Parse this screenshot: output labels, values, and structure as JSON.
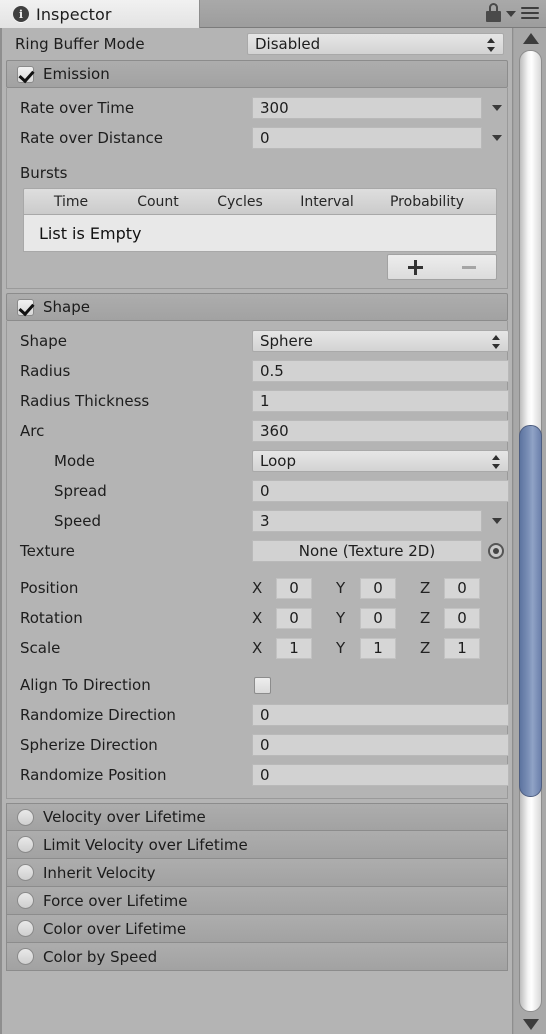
{
  "window": {
    "tab_label": "Inspector",
    "info_icon": "info-icon",
    "lock_icon": "lock-icon",
    "menu_icon": "hamburger-menu-icon"
  },
  "top_field": {
    "label": "Ring Buffer Mode",
    "value": "Disabled"
  },
  "emission": {
    "title": "Emission",
    "enabled": true,
    "rate_over_time": {
      "label": "Rate over Time",
      "value": "300"
    },
    "rate_over_distance": {
      "label": "Rate over Distance",
      "value": "0"
    },
    "bursts_label": "Bursts",
    "bursts_columns": [
      "Time",
      "Count",
      "Cycles",
      "Interval",
      "Probability"
    ],
    "bursts_empty_text": "List is Empty",
    "add_label": "+",
    "remove_label": "−"
  },
  "shape": {
    "title": "Shape",
    "enabled": true,
    "rows": [
      {
        "label": "Shape",
        "value": "Sphere",
        "type": "popup"
      },
      {
        "label": "Radius",
        "value": "0.5",
        "type": "text"
      },
      {
        "label": "Radius Thickness",
        "value": "1",
        "type": "text"
      },
      {
        "label": "Arc",
        "value": "360",
        "type": "text"
      },
      {
        "label": "Mode",
        "value": "Loop",
        "type": "popup",
        "indent": true
      },
      {
        "label": "Spread",
        "value": "0",
        "type": "text",
        "indent": true
      },
      {
        "label": "Speed",
        "value": "3",
        "type": "text-caret",
        "indent": true
      },
      {
        "label": "Texture",
        "value": "None (Texture 2D)",
        "type": "object"
      }
    ],
    "position": {
      "label": "Position",
      "x": "0",
      "y": "0",
      "z": "0"
    },
    "rotation": {
      "label": "Rotation",
      "x": "0",
      "y": "0",
      "z": "0"
    },
    "scale": {
      "label": "Scale",
      "x": "1",
      "y": "1",
      "z": "1"
    },
    "axes": {
      "x": "X",
      "y": "Y",
      "z": "Z"
    },
    "align_to_direction": {
      "label": "Align To Direction",
      "checked": false
    },
    "randomize_direction": {
      "label": "Randomize Direction",
      "value": "0"
    },
    "spherize_direction": {
      "label": "Spherize Direction",
      "value": "0"
    },
    "randomize_position": {
      "label": "Randomize Position",
      "value": "0"
    }
  },
  "collapsed_modules": [
    {
      "title": "Velocity over Lifetime",
      "enabled": false
    },
    {
      "title": "Limit Velocity over Lifetime",
      "enabled": false
    },
    {
      "title": "Inherit Velocity",
      "enabled": false
    },
    {
      "title": "Force over Lifetime",
      "enabled": false
    },
    {
      "title": "Color over Lifetime",
      "enabled": false
    },
    {
      "title": "Color by Speed",
      "enabled": false
    }
  ],
  "scrollbar": {
    "up_arrow": "scroll-up-arrow-icon",
    "down_arrow": "scroll-down-arrow-icon"
  },
  "colors": {
    "panel_bg": "#b4b4b4",
    "header_bg": "#a8a8a8",
    "field_bg": "#d2d2d2",
    "scroll_thumb": "#7b90b7",
    "text": "#1d1d1d"
  }
}
